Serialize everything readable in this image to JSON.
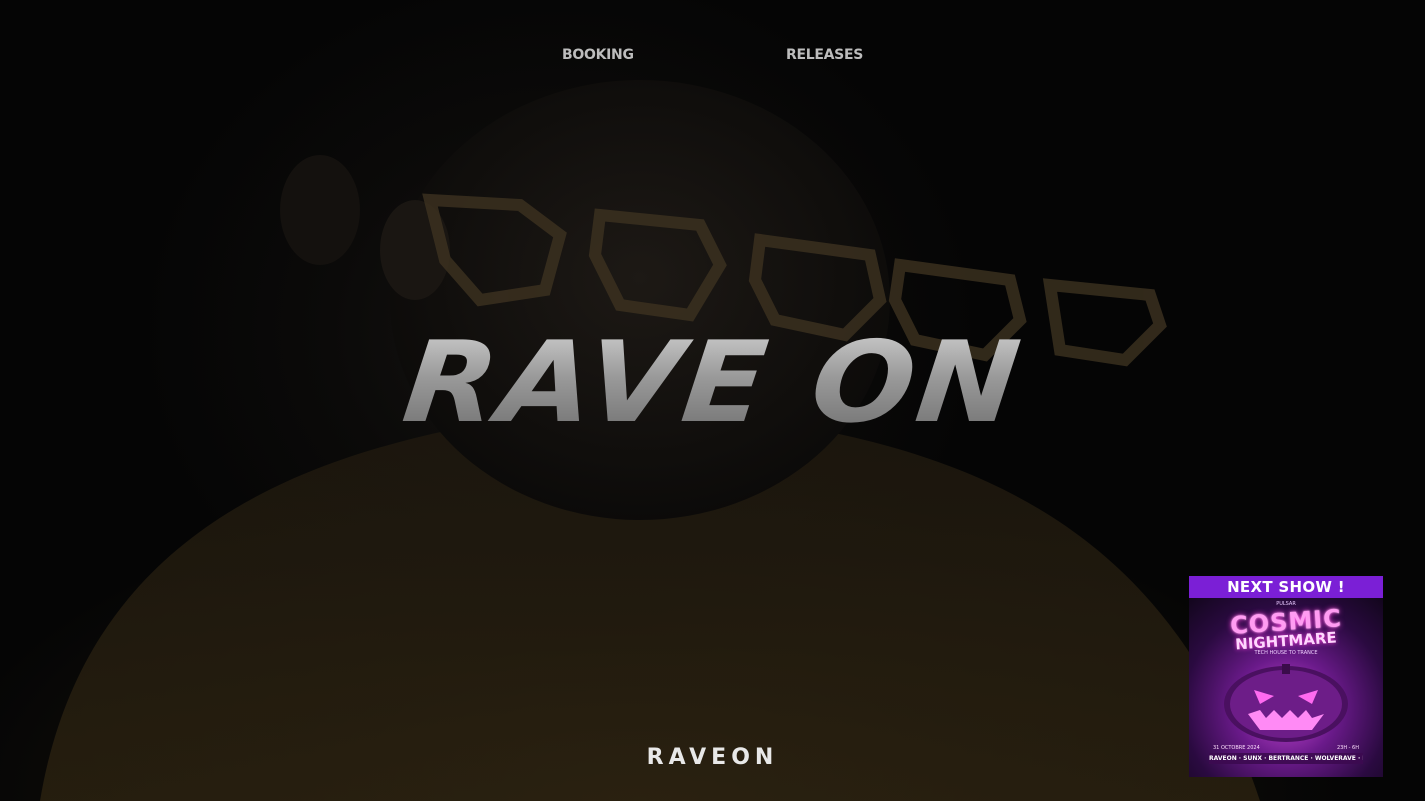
{
  "nav": {
    "booking_label": "BOOKING",
    "releases_label": "RELEASES"
  },
  "hero": {
    "headline": "RAVE ON"
  },
  "footer": {
    "logo_text": "RAVEON"
  },
  "next_show": {
    "header_label": "NEXT SHOW !",
    "poster": {
      "top_small_text": "PULSAR",
      "title_line_1": "COSMIC",
      "title_line_2": "NIGHTMARE",
      "subtitle": "TECH HOUSE TO TRANCE",
      "date": "31 OCTOBRE 2024",
      "time": "23H - 6H",
      "lineup": "RAVEON · SUNX · BERTRANCE · WOLVERAVE · KOAL HB"
    },
    "accent_color": "#7b1fd6"
  },
  "colors": {
    "background": "#050505",
    "nav_text": "#bdbdbd",
    "logo_text": "#e8e8e8"
  }
}
